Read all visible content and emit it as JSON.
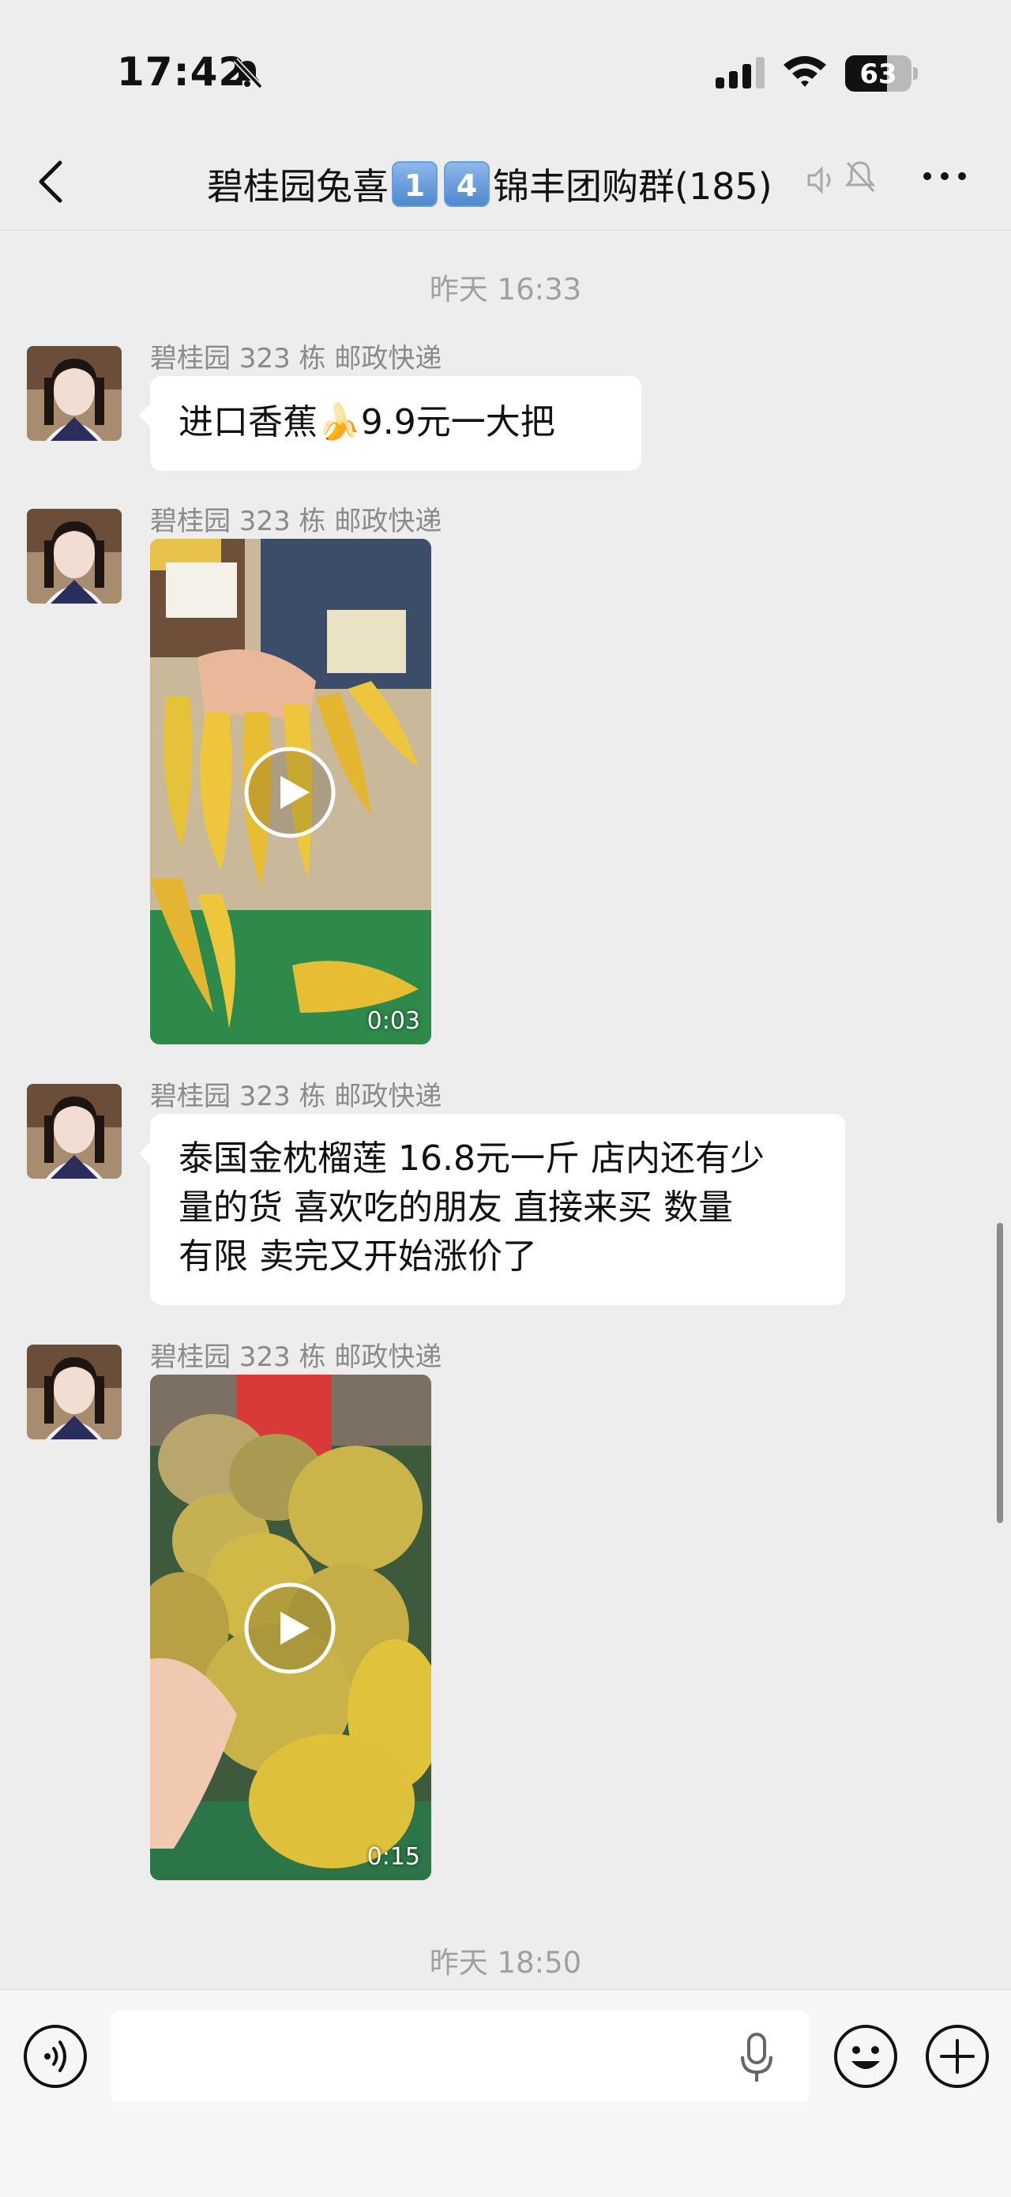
{
  "status_bar": {
    "time": "17:42",
    "battery": "63",
    "battery_level": 0.63
  },
  "nav": {
    "title_prefix": "碧桂园兔喜",
    "badge_1": "1",
    "badge_2": "4",
    "title_suffix": "锦丰团购群(185)"
  },
  "chat": {
    "timestamps": [
      "昨天 16:33",
      "昨天 18:50"
    ],
    "messages": [
      {
        "sender": "碧桂园 323 栋 邮政快递",
        "type": "text",
        "text": "进口香蕉🍌9.9元一大把"
      },
      {
        "sender": "碧桂园 323 栋 邮政快递",
        "type": "video",
        "duration": "0:03"
      },
      {
        "sender": "碧桂园 323 栋 邮政快递",
        "type": "text",
        "text_lines": [
          "泰国金枕榴莲 16.8元一斤 店内还有少",
          "量的货 喜欢吃的朋友 直接来买 数量",
          "有限 卖完又开始涨价了"
        ]
      },
      {
        "sender": "碧桂园 323 栋 邮政快递",
        "type": "video",
        "duration": "0:15"
      }
    ]
  },
  "input_bar": {
    "placeholder": ""
  },
  "icons": [
    "bell-slash-icon",
    "signal-icon",
    "wifi-icon",
    "battery-icon",
    "back-icon",
    "voice-off-icon",
    "mute-icon",
    "more-icon",
    "play-icon",
    "voice-icon",
    "microphone-icon",
    "emoji-icon",
    "plus-icon"
  ]
}
